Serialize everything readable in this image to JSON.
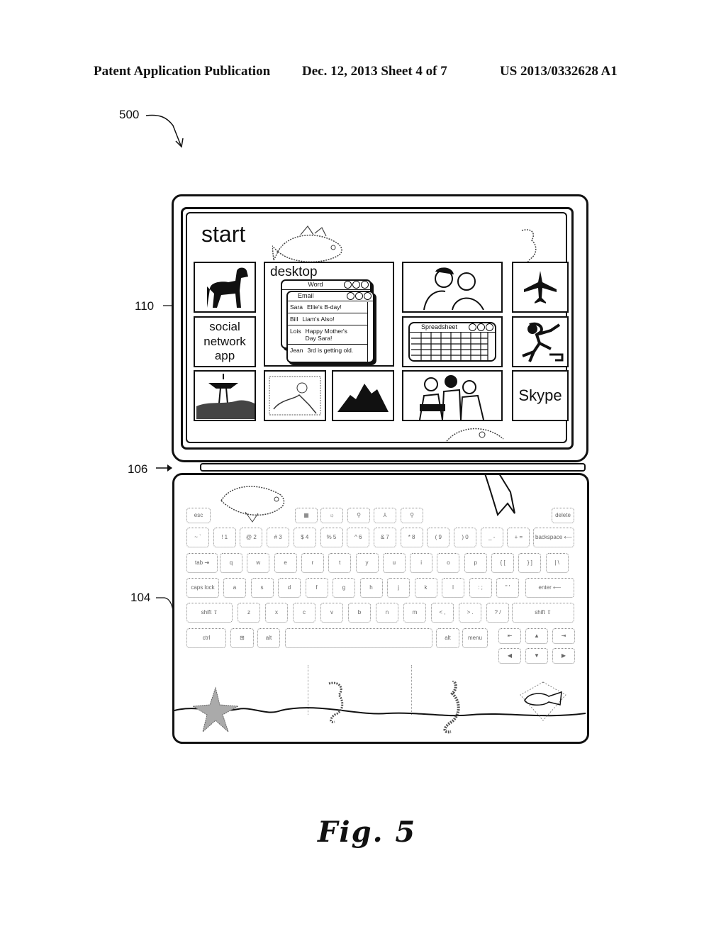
{
  "header": {
    "left": "Patent Application Publication",
    "middle": "Dec. 12, 2013   Sheet 4 of 7",
    "right": "US 2013/0332628 A1"
  },
  "refs": {
    "figure": "500",
    "display": "110",
    "hinge": "106",
    "keyboard": "104"
  },
  "screen": {
    "title": "start",
    "tiles": {
      "social": "social network app",
      "desktop": "desktop",
      "skype": "Skype",
      "spreadsheet": "Spreadsheet"
    },
    "word_window": {
      "title": "Word"
    },
    "email_window": {
      "title": "Email",
      "rows": [
        {
          "from": "Sara",
          "subject": "Ellie's B-day!"
        },
        {
          "from": "Bill",
          "subject": "Liam's Also!"
        },
        {
          "from": "Lois",
          "subject": "Happy Mother's Day Sara!"
        },
        {
          "from": "Jean",
          "subject": "3rd is getting old."
        }
      ]
    }
  },
  "keyboard": {
    "top_row": [
      "esc",
      "▦",
      "☼",
      "⚲",
      "⅄",
      "⚲",
      "delete"
    ],
    "number_row": [
      "~ `",
      "! 1",
      "@ 2",
      "# 3",
      "$ 4",
      "% 5",
      "^ 6",
      "& 7",
      "* 8",
      "( 9",
      ") 0",
      "_ -",
      "+ =",
      "backspace ⟵"
    ],
    "qwerty_row": [
      "tab ⇥",
      "q",
      "w",
      "e",
      "r",
      "t",
      "y",
      "u",
      "i",
      "o",
      "p",
      "{ [",
      "} ]",
      "| \\"
    ],
    "home_row": [
      "caps lock",
      "a",
      "s",
      "d",
      "f",
      "g",
      "h",
      "j",
      "k",
      "l",
      ": ;",
      "\" '",
      "enter ⟵"
    ],
    "shift_row": [
      "shift ⇧",
      "z",
      "x",
      "c",
      "v",
      "b",
      "n",
      "m",
      "< ,",
      "> .",
      "? /",
      "shift ⇧"
    ],
    "bottom_row": [
      "ctrl",
      "⊞",
      "alt",
      "",
      "alt",
      "menu"
    ],
    "arrows": [
      "⇤",
      "▲",
      "⇥",
      "◀",
      "▼",
      "▶"
    ]
  },
  "caption": "Fig. 5"
}
